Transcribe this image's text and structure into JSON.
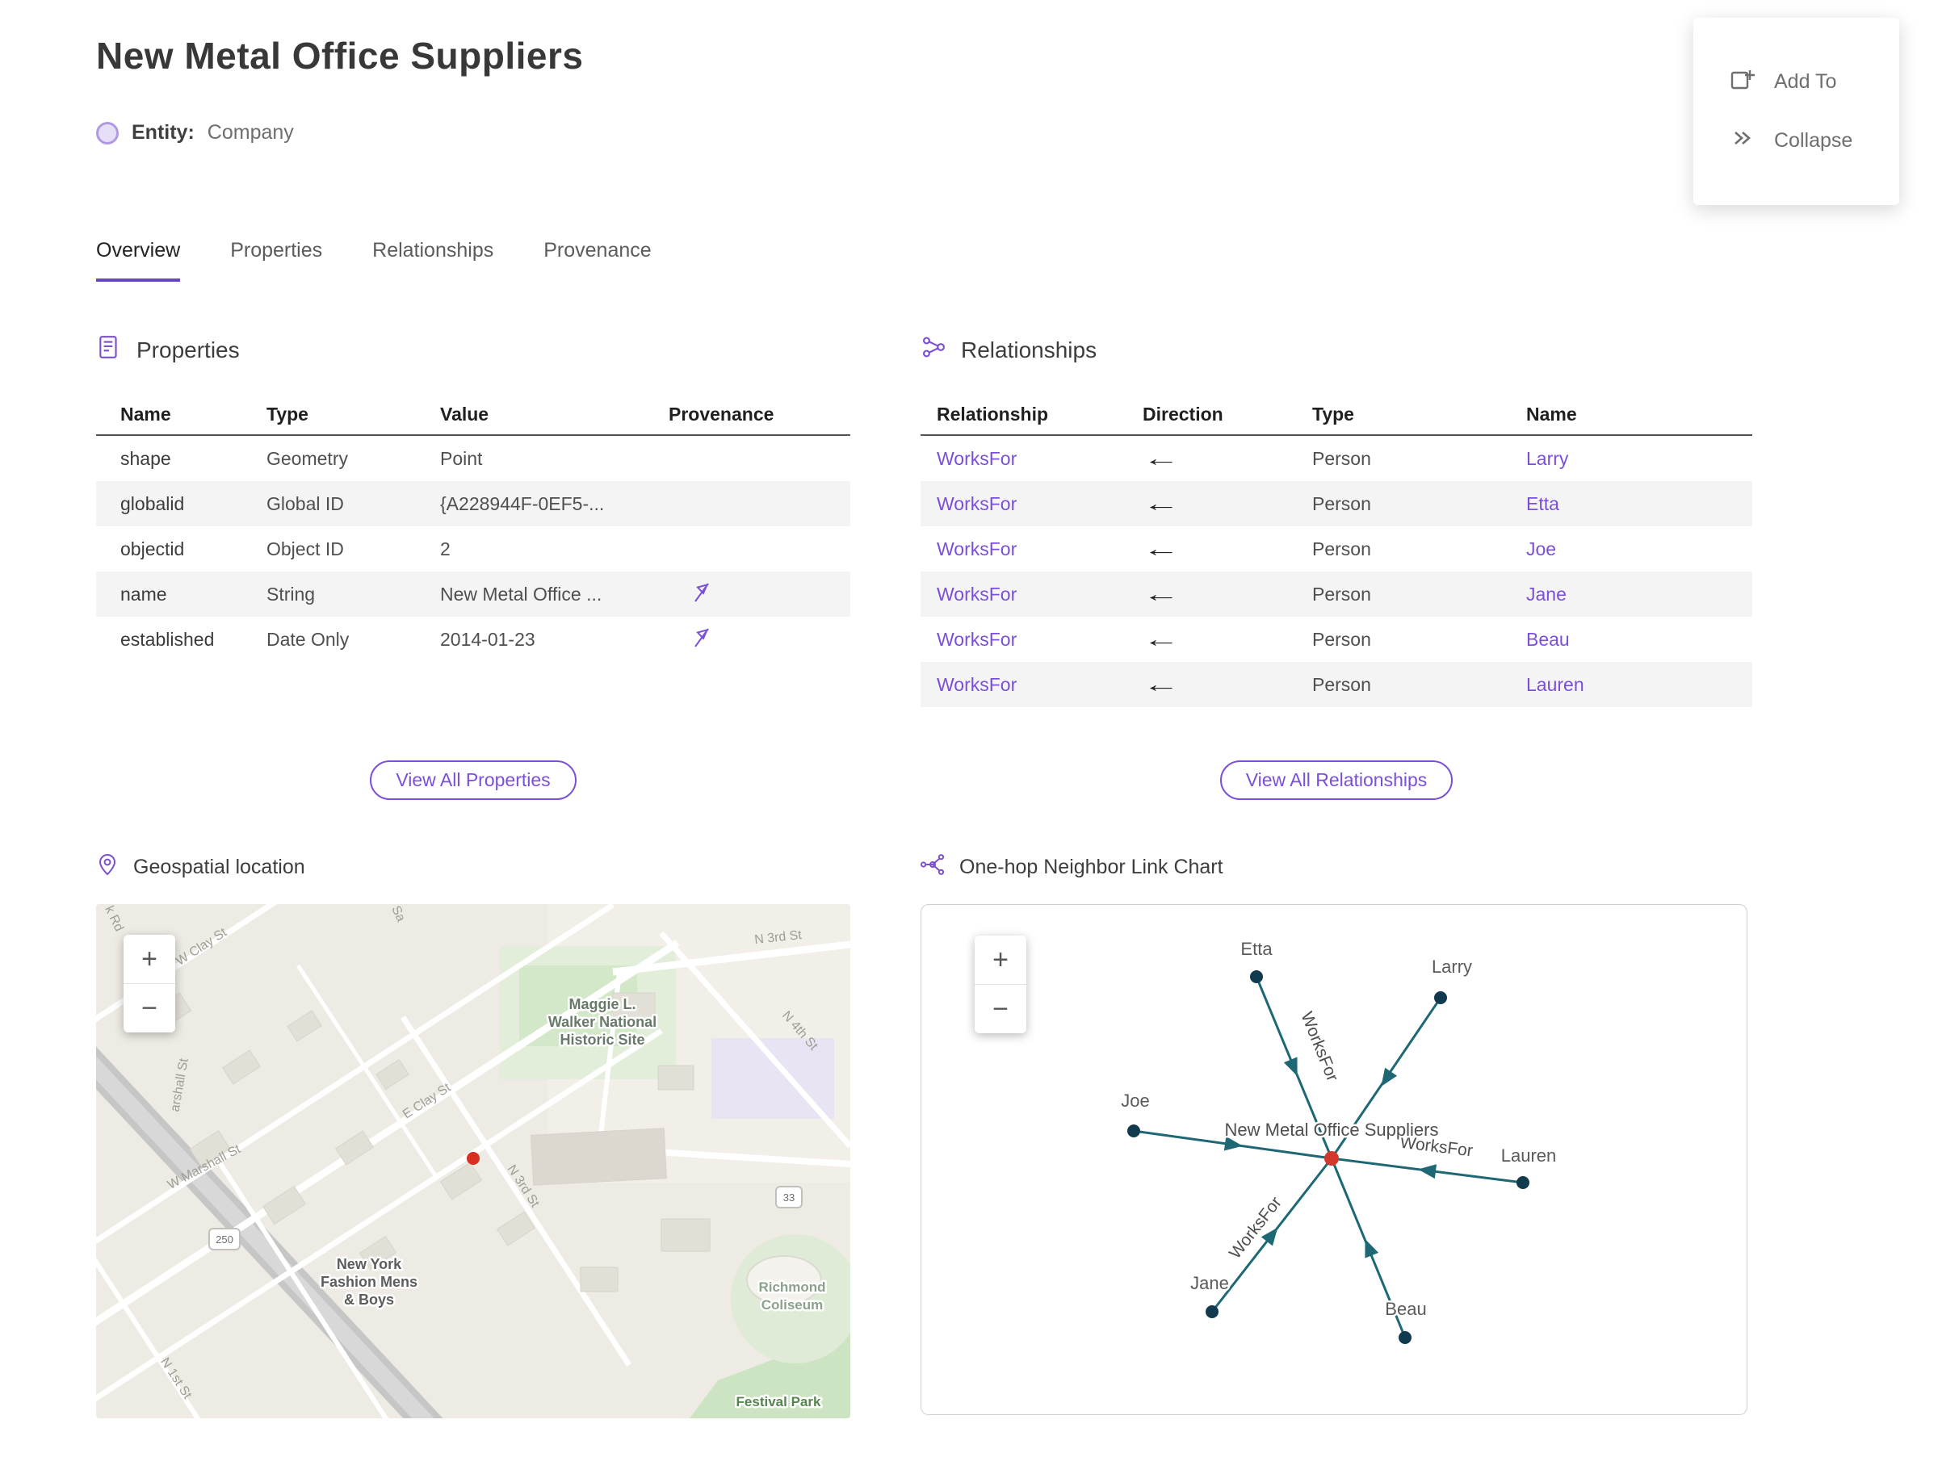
{
  "page": {
    "title": "New Metal Office Suppliers",
    "entity_label": "Entity:",
    "entity_type": "Company"
  },
  "actions": {
    "add_to": "Add To",
    "collapse": "Collapse"
  },
  "tabs": {
    "overview": "Overview",
    "properties": "Properties",
    "relationships": "Relationships",
    "provenance": "Provenance"
  },
  "properties_section": {
    "title": "Properties",
    "columns": [
      "Name",
      "Type",
      "Value",
      "Provenance"
    ],
    "rows": [
      {
        "name": "shape",
        "type": "Geometry",
        "value": "Point"
      },
      {
        "name": "globalid",
        "type": "Global ID",
        "value": "{A228944F-0EF5-..."
      },
      {
        "name": "objectid",
        "type": "Object ID",
        "value": "2"
      },
      {
        "name": "name",
        "type": "String",
        "value": "New Metal Office ..."
      },
      {
        "name": "established",
        "type": "Date Only",
        "value": "2014-01-23"
      }
    ],
    "view_all": "View All Properties"
  },
  "relationships_section": {
    "title": "Relationships",
    "columns": [
      "Relationship",
      "Direction",
      "Type",
      "Name"
    ],
    "rows": [
      {
        "relationship": "WorksFor",
        "direction": "←",
        "type": "Person",
        "name": "Larry"
      },
      {
        "relationship": "WorksFor",
        "direction": "←",
        "type": "Person",
        "name": "Etta"
      },
      {
        "relationship": "WorksFor",
        "direction": "←",
        "type": "Person",
        "name": "Joe"
      },
      {
        "relationship": "WorksFor",
        "direction": "←",
        "type": "Person",
        "name": "Jane"
      },
      {
        "relationship": "WorksFor",
        "direction": "←",
        "type": "Person",
        "name": "Beau"
      },
      {
        "relationship": "WorksFor",
        "direction": "←",
        "type": "Person",
        "name": "Lauren"
      }
    ],
    "view_all": "View All Relationships"
  },
  "map_section": {
    "title": "Geospatial location",
    "zoom_in": "+",
    "zoom_out": "−",
    "shields": {
      "s250": "250",
      "s33": "33"
    },
    "streets": {
      "k_rd": "k Rd",
      "sa": "Sa",
      "w_clay": "W Clay St",
      "n3_top": "N 3rd St",
      "n4": "N 4th St",
      "marshall_partial": "arshall St",
      "e_clay": "E Clay St",
      "w_marshall": "W Marshall St",
      "n3_mid": "N 3rd St",
      "n1": "N 1st St"
    },
    "places": {
      "maggie_1": "Maggie L.",
      "maggie_2": "Walker National",
      "maggie_3": "Historic Site",
      "nyfm_1": "New York",
      "nyfm_2": "Fashion Mens",
      "nyfm_3": "& Boys",
      "coliseum_1": "Richmond",
      "coliseum_2": "Coliseum",
      "festival": "Festival Park"
    }
  },
  "graph_section": {
    "title": "One-hop Neighbor Link Chart",
    "zoom_in": "+",
    "zoom_out": "−",
    "center_label": "New Metal Office Suppliers",
    "edge_label": "WorksFor",
    "nodes": [
      "Etta",
      "Larry",
      "Joe",
      "Lauren",
      "Jane",
      "Beau"
    ]
  },
  "colors": {
    "accent_purple": "#7b4fd8",
    "tab_underline": "#6a44c8",
    "row_stripe": "#f4f4f4",
    "graph_edge_teal": "#1e6876",
    "graph_node_dark": "#123a4e",
    "graph_center_red": "#d2382c",
    "map_marker_red": "#d83020"
  }
}
